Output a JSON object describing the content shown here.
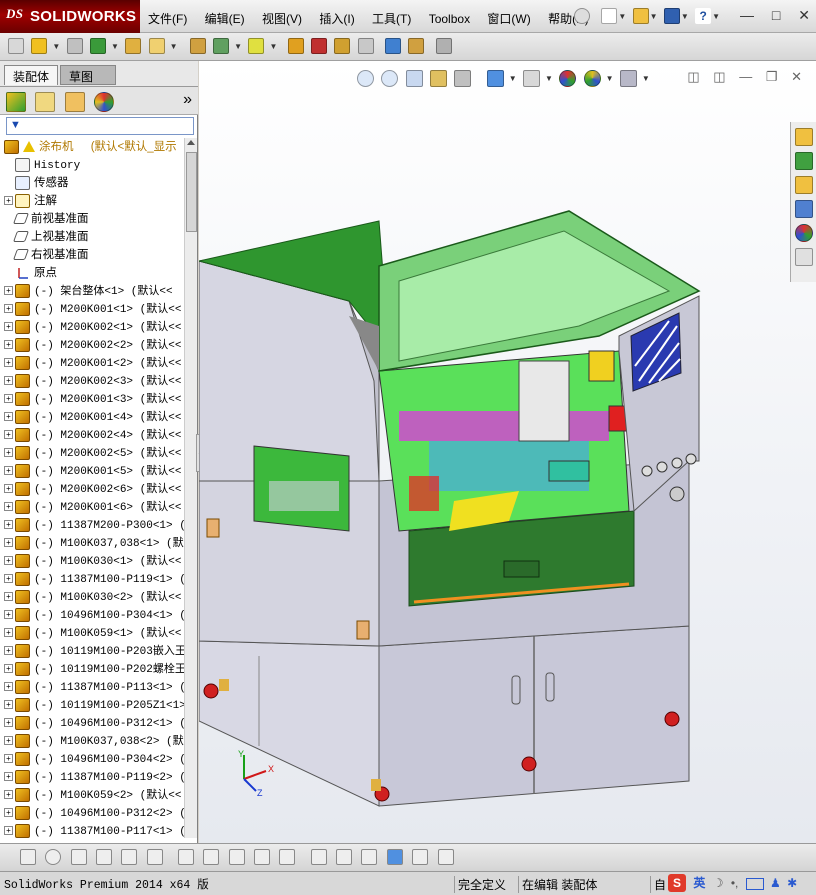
{
  "app": {
    "name": "SOLIDWORKS",
    "logo_prefix": "DS"
  },
  "menu": [
    "文件(F)",
    "编辑(E)",
    "视图(V)",
    "插入(I)",
    "工具(T)",
    "Toolbox",
    "窗口(W)",
    "帮助(H)"
  ],
  "window_controls": [
    "—",
    "□",
    "✕"
  ],
  "panel": {
    "tabs": [
      "装配体",
      "草图"
    ],
    "expand_glyph": "»",
    "filter_glyph": "▼"
  },
  "tree": {
    "root": {
      "name": "涂布机",
      "config": "(默认<默认_显示"
    },
    "items": [
      {
        "label": "History",
        "icon": "history-icon",
        "expandable": false
      },
      {
        "label": "传感器",
        "icon": "sensor-icon",
        "expandable": false
      },
      {
        "label": "注解",
        "icon": "annotation-icon",
        "expandable": true
      },
      {
        "label": "前视基准面",
        "icon": "plane-icon",
        "expandable": false
      },
      {
        "label": "上视基准面",
        "icon": "plane-icon",
        "expandable": false
      },
      {
        "label": "右视基准面",
        "icon": "plane-icon",
        "expandable": false
      },
      {
        "label": "原点",
        "icon": "origin-icon",
        "expandable": false
      }
    ],
    "components": [
      "(-) 架台整体<1> (默认<<",
      "(-) M200K001<1> (默认<<",
      "(-) M200K002<1> (默认<<",
      "(-) M200K002<2> (默认<<",
      "(-) M200K001<2> (默认<<",
      "(-) M200K002<3> (默认<<",
      "(-) M200K001<3> (默认<<",
      "(-) M200K001<4> (默认<<",
      "(-) M200K002<4> (默认<<",
      "(-) M200K002<5> (默认<<",
      "(-) M200K001<5> (默认<<",
      "(-) M200K002<6> (默认<<",
      "(-) M200K001<6> (默认<<",
      "(-) 11387M200-P300<1> (",
      "(-) M100K037,038<1> (默",
      "(-) M100K030<1> (默认<<",
      "(-) 11387M100-P119<1> (",
      "(-) M100K030<2> (默认<<",
      "(-) 10496M100-P304<1> (",
      "(-) M100K059<1> (默认<<",
      "(-) 10119M100-P203嵌入王",
      "(-) 10119M100-P202螺栓王",
      "(-) 11387M100-P113<1> (",
      "(-) 10119M100-P205Z1<1>",
      "(-) 10496M100-P312<1> (",
      "(-) M100K037,038<2> (默",
      "(-) 10496M100-P304<2> (",
      "(-) 11387M100-P119<2> (",
      "(-) M100K059<2> (默认<<",
      "(-) 10496M100-P312<2> (",
      "(-) 11387M100-P117<1> ("
    ]
  },
  "triad": {
    "x": "X",
    "y": "Y",
    "z": "Z"
  },
  "statusbar": {
    "left": "SolidWorks Premium 2014 x64 版",
    "definition": "完全定义",
    "editing": "在编辑 装配体",
    "custom": "自",
    "ime_lang": "英",
    "ime_logo": "S"
  },
  "colors": {
    "accent": "#a00000",
    "machine_green": "#3fa63f",
    "machine_lid": "#8fe08f",
    "cabinet": "#c6c6d6"
  }
}
